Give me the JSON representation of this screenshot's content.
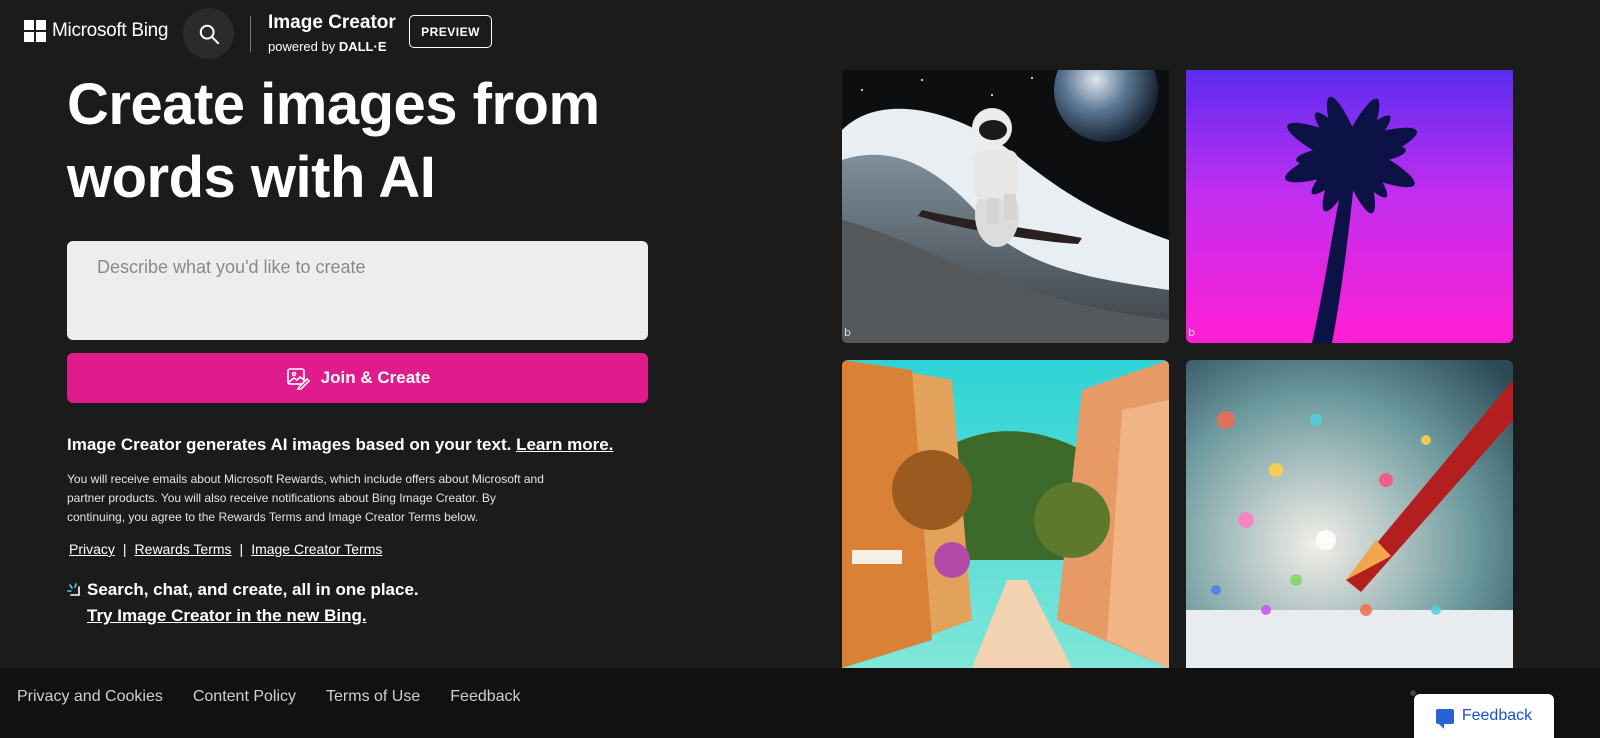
{
  "header": {
    "ms_logo_text": "Microsoft Bing",
    "search_icon": "search-icon",
    "brand_title": "Image Creator",
    "brand_powered": "powered by",
    "brand_engine": "DALL·E",
    "preview_label": "PREVIEW"
  },
  "hero": {
    "title": "Create images from words with AI",
    "prompt_placeholder": "Describe what you'd like to create",
    "join_label": "Join & Create",
    "join_icon": "image-edit-icon"
  },
  "info": {
    "text": "Image Creator generates AI images based on your text.",
    "learn_more": "Learn more.",
    "disclaimer": "You will receive emails about Microsoft Rewards, which include offers about Microsoft and partner products. You will also receive notifications about Bing Image Creator. By continuing, you agree to the Rewards Terms and Image Creator Terms below.",
    "links": [
      "Privacy",
      "Rewards Terms",
      "Image Creator Terms"
    ],
    "separator": "|"
  },
  "promo": {
    "text": "Search, chat, and create, all in one place.",
    "link": "Try Image Creator in the new Bing.",
    "icon": "sparkle-icon"
  },
  "gallery": {
    "watermark": "b",
    "images": [
      "astronaut-surfing-image",
      "neon-palm-tree-image",
      "sunny-street-image",
      "glitter-pencil-image"
    ]
  },
  "footer": {
    "links": [
      "Privacy and Cookies",
      "Content Policy",
      "Terms of Use",
      "Feedback"
    ],
    "feedback_button": "Feedback"
  },
  "colors": {
    "background": "#1c1b1b",
    "accent": "#e01c8c",
    "input_bg": "#ededed",
    "footer_bg": "#111111",
    "feedback_text": "#1a53c4"
  }
}
